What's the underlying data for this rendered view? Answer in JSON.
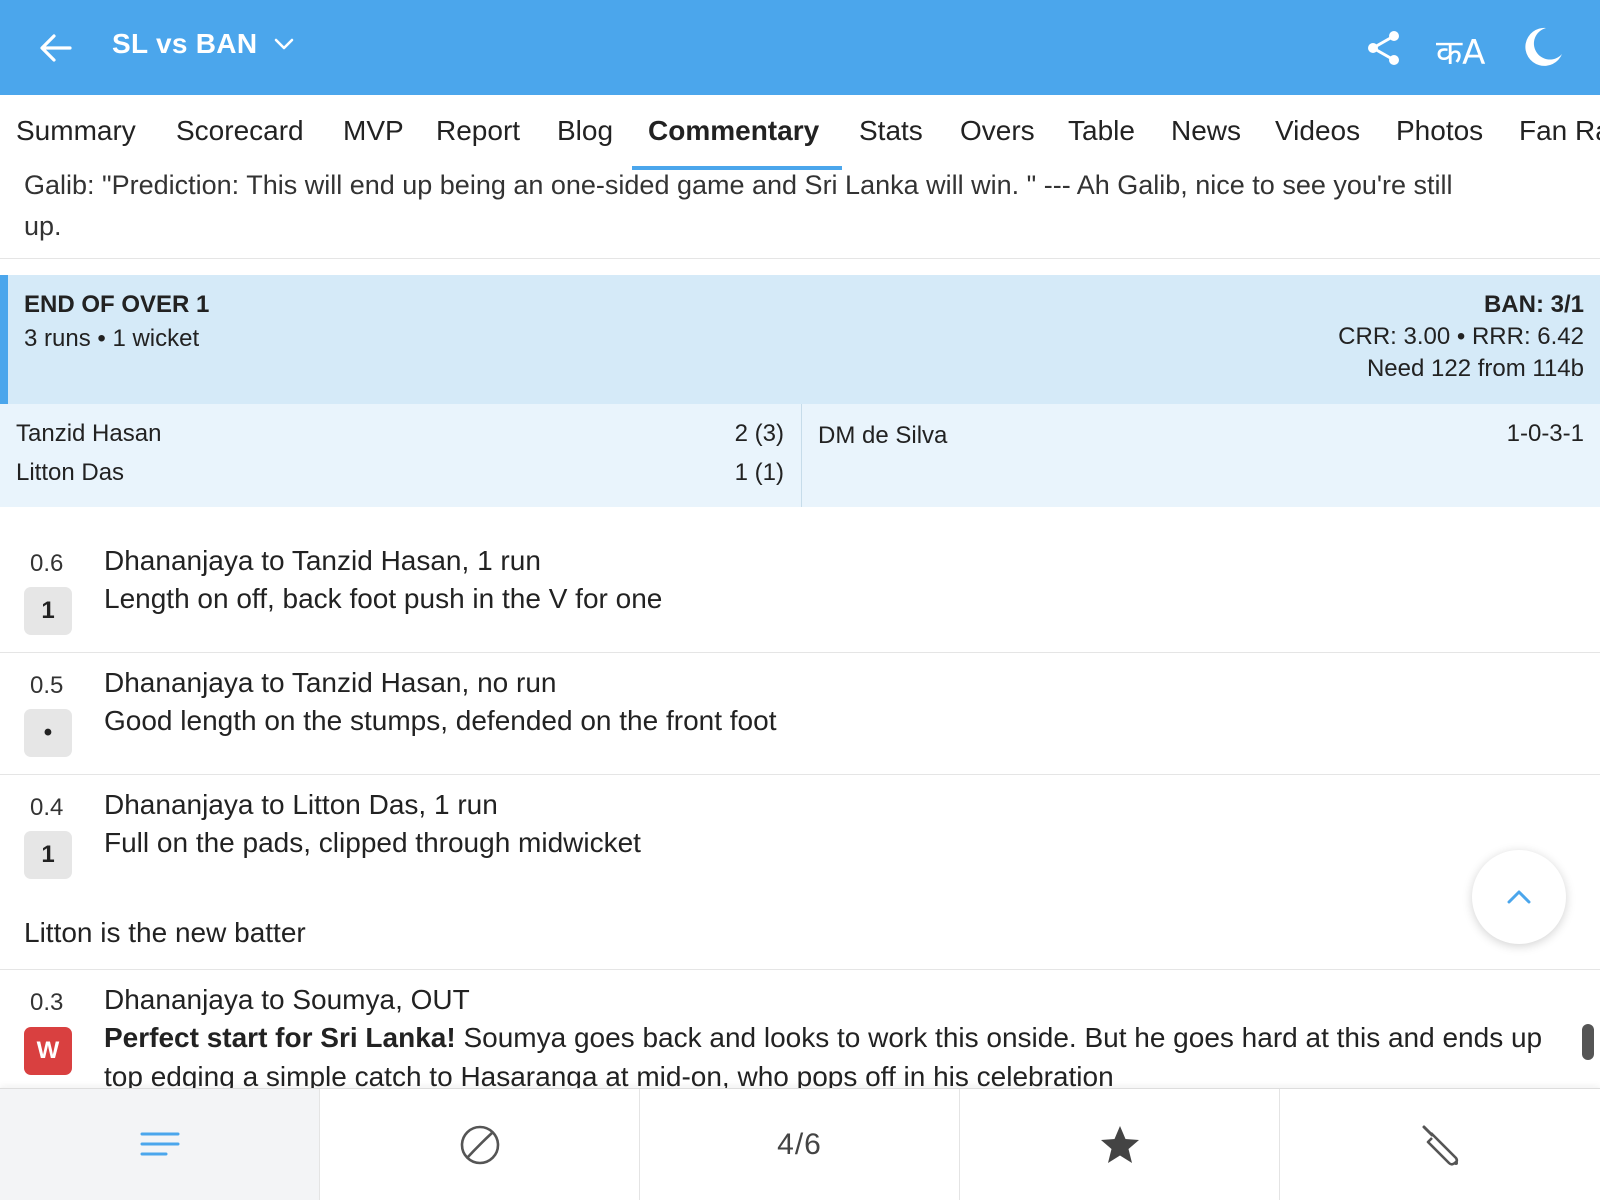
{
  "header": {
    "title": "SL vs BAN",
    "language_label": "क​A",
    "icons": [
      "back-arrow-icon",
      "chevron-down-icon",
      "share-icon",
      "language-icon",
      "moon-icon"
    ],
    "bg_color": "#4BA6EC"
  },
  "tabs": [
    {
      "label": "Summary"
    },
    {
      "label": "Scorecard"
    },
    {
      "label": "MVP"
    },
    {
      "label": "Report"
    },
    {
      "label": "Blog"
    },
    {
      "label": "Commentary",
      "active": true
    },
    {
      "label": "Stats"
    },
    {
      "label": "Overs"
    },
    {
      "label": "Table"
    },
    {
      "label": "News"
    },
    {
      "label": "Videos"
    },
    {
      "label": "Photos"
    },
    {
      "label": "Fan Ra"
    }
  ],
  "prev_comment": {
    "line1": "Galib: \"Prediction: This will end up being an one-sided game and Sri Lanka will win. \" --- Ah Galib, nice to see you're still",
    "line2": "up."
  },
  "over_summary": {
    "title": "END OF OVER 1",
    "runs_wickets": "3 runs • 1 wicket",
    "score": "BAN: 3/1",
    "rates": "CRR: 3.00 • RRR: 6.42",
    "need": "Need 122 from 114b",
    "accent_color": "#4BA6EC",
    "batters": [
      {
        "name": "Tanzid Hasan",
        "score": "2 (3)"
      },
      {
        "name": "Litton Das",
        "score": "1 (1)"
      }
    ],
    "bowler": {
      "name": "DM de Silva",
      "figures": "1-0-3-1"
    }
  },
  "commentary": [
    {
      "ball": "0.6",
      "badge": "1",
      "title": "Dhananjaya to Tanzid Hasan, 1 run",
      "text": "Length on off, back foot push in the V for one"
    },
    {
      "ball": "0.5",
      "badge": "•",
      "title": "Dhananjaya to Tanzid Hasan, no run",
      "text": "Good length on the stumps, defended on the front foot"
    },
    {
      "ball": "0.4",
      "badge": "1",
      "title": "Dhananjaya to Litton Das, 1 run",
      "text": "Full on the pads, clipped through midwicket"
    },
    {
      "ball": "0.3",
      "badge": "W",
      "title": "Dhananjaya to Soumya, OUT",
      "bold_text": "Perfect start for Sri Lanka!",
      "text": " Soumya goes back and looks to work this onside. But he goes hard at this and ends up",
      "text2": "top edging a simple catch to Hasaranga at mid-on, who pops off in his celebration",
      "wicket_color": "#D94040"
    }
  ],
  "new_batter_note": "Litton is the new batter",
  "bottom_nav": {
    "items": [
      "menu-icon",
      "ball-icon",
      "4/6",
      "star-icon",
      "bat-icon"
    ],
    "page_label": "4/6"
  }
}
